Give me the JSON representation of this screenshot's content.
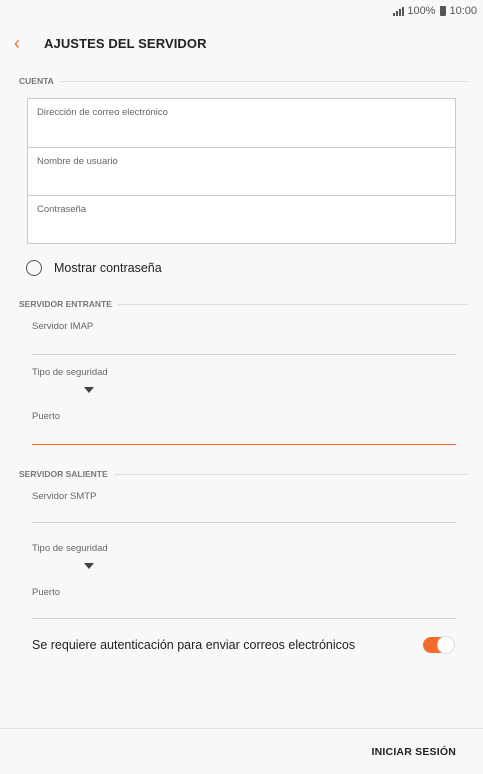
{
  "status_bar": {
    "battery": "100%",
    "time": "10:00"
  },
  "app_bar": {
    "title": "AJUSTES DEL SERVIDOR"
  },
  "account": {
    "header": "CUENTA",
    "email_label": "Dirección de correo electrónico",
    "username_label": "Nombre de usuario",
    "password_label": "Contraseña",
    "show_password_label": "Mostrar contraseña"
  },
  "incoming": {
    "header": "SERVIDOR ENTRANTE",
    "server_label": "Servidor IMAP",
    "security_label": "Tipo de seguridad",
    "port_label": "Puerto"
  },
  "outgoing": {
    "header": "SERVIDOR SALIENTE",
    "server_label": "Servidor SMTP",
    "security_label": "Tipo de seguridad",
    "port_label": "Puerto",
    "auth_label": "Se requiere autenticación para enviar correos electrónicos",
    "auth_enabled": true
  },
  "footer": {
    "login_label": "INICIAR SESIÓN"
  },
  "colors": {
    "accent": "#f26a2c"
  },
  "icons": {
    "back": "chevron-left-icon",
    "signal": "signal-icon",
    "battery": "battery-icon",
    "dropdown": "dropdown-arrow-icon",
    "radio": "radio-icon"
  }
}
